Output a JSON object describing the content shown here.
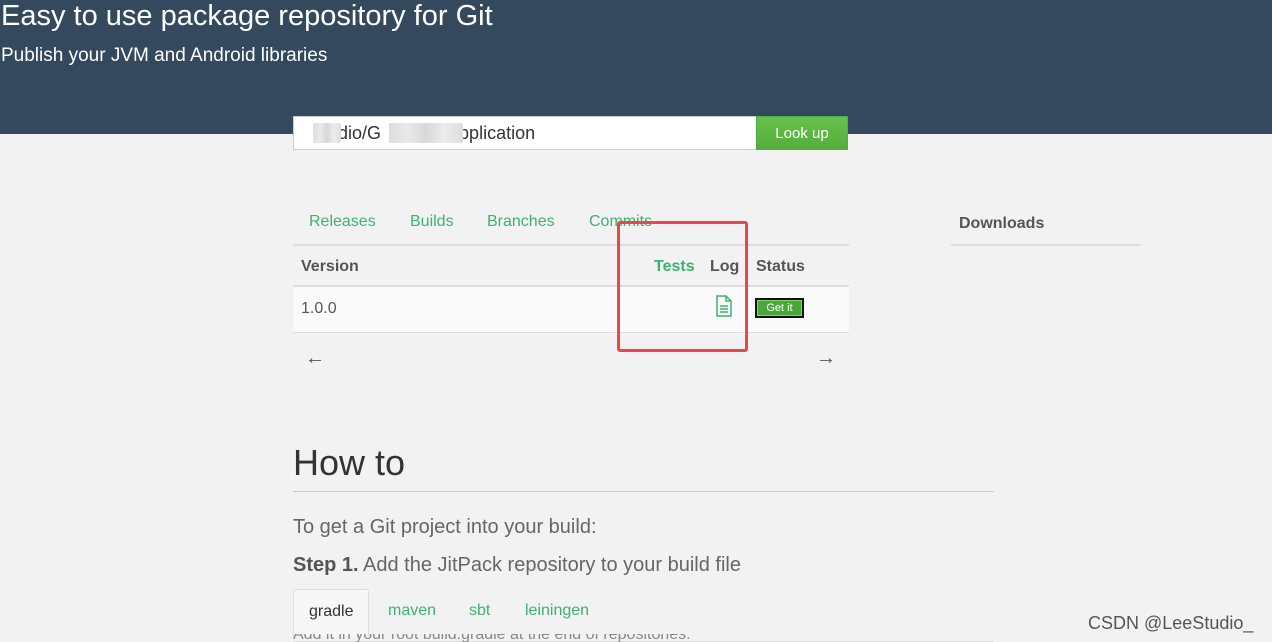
{
  "header": {
    "title": "Easy to use package repository for Git",
    "subtitle": "Publish your JVM and Android libraries"
  },
  "search": {
    "value": "dio/G          erApplication",
    "button_label": "Look up"
  },
  "tabs": [
    {
      "label": "Releases"
    },
    {
      "label": "Builds"
    },
    {
      "label": "Branches"
    },
    {
      "label": "Commits"
    }
  ],
  "downloads": {
    "label": "Downloads"
  },
  "table": {
    "headers": {
      "version": "Version",
      "tests": "Tests",
      "log": "Log",
      "status": "Status"
    },
    "rows": [
      {
        "version": "1.0.0",
        "status_button": "Get it"
      }
    ],
    "prev_arrow": "←",
    "next_arrow": "→"
  },
  "howto": {
    "title": "How to",
    "intro": "To get a Git project into your build:",
    "step_label": "Step 1.",
    "step_text": " Add the JitPack repository to your build file",
    "build_tabs": [
      {
        "label": "gradle"
      },
      {
        "label": "maven"
      },
      {
        "label": "sbt"
      },
      {
        "label": "leiningen"
      }
    ],
    "cutoff_text": "Add it in your root build.gradle at the end of repositories:"
  },
  "colors": {
    "header_bg": "#34495e",
    "accent_green": "#3cb371",
    "button_green": "#5cb85c",
    "highlight_red": "#e8474c"
  },
  "icons": {
    "log": "file-text-icon"
  },
  "watermark": "CSDN @LeeStudio_"
}
